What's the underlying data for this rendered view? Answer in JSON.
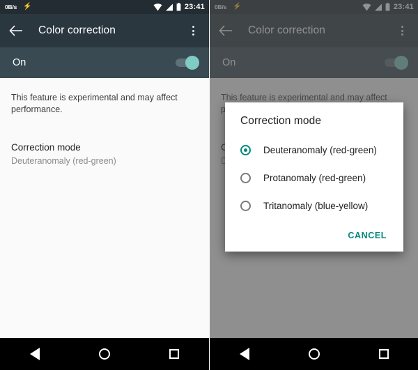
{
  "statusbar": {
    "network_speed": "0B/s",
    "flash_icon": "flash-icon",
    "wifi_icon": "wifi-icon",
    "signal_icon": "cellular-signal-icon",
    "battery_icon": "battery-icon",
    "time": "23:41"
  },
  "appbar": {
    "back_icon": "back-arrow-icon",
    "title": "Color correction",
    "overflow_icon": "overflow-menu-icon"
  },
  "switch_row": {
    "label": "On",
    "state": "on"
  },
  "content": {
    "note": "This feature is experimental and may affect performance.",
    "preference": {
      "title": "Correction mode",
      "value": "Deuteranomaly (red-green)"
    }
  },
  "dialog": {
    "title": "Correction mode",
    "options": [
      {
        "label": "Deuteranomaly (red-green)",
        "selected": true
      },
      {
        "label": "Protanomaly (red-green)",
        "selected": false
      },
      {
        "label": "Tritanomaly (blue-yellow)",
        "selected": false
      }
    ],
    "cancel_label": "CANCEL"
  },
  "navbar": {
    "back": "nav-back-icon",
    "home": "nav-home-icon",
    "recents": "nav-recents-icon"
  },
  "colors": {
    "appbar_bg": "#2B373F",
    "statusbar_bg": "#232C33",
    "switch_band_bg": "#3A4A52",
    "accent_teal": "#00897B",
    "switch_thumb": "#80CBC4",
    "content_bg": "#FAFAFA",
    "navbar_bg": "#000000"
  }
}
